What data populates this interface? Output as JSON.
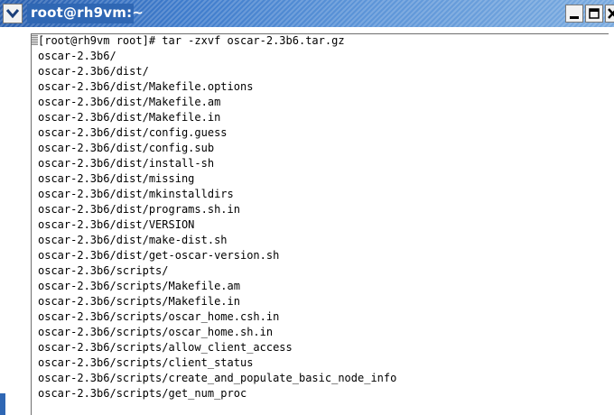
{
  "window": {
    "title": "root@rh9vm:~",
    "controls": [
      "minimize-icon",
      "maximize-icon",
      "close-icon"
    ]
  },
  "colors": {
    "titlebar": "#2c66b4",
    "title_text": "#ffffff",
    "terminal_bg": "#ffffff",
    "terminal_text": "#000000"
  },
  "terminal": {
    "lines": [
      "[root@rh9vm root]# tar -zxvf oscar-2.3b6.tar.gz",
      "oscar-2.3b6/",
      "oscar-2.3b6/dist/",
      "oscar-2.3b6/dist/Makefile.options",
      "oscar-2.3b6/dist/Makefile.am",
      "oscar-2.3b6/dist/Makefile.in",
      "oscar-2.3b6/dist/config.guess",
      "oscar-2.3b6/dist/config.sub",
      "oscar-2.3b6/dist/install-sh",
      "oscar-2.3b6/dist/missing",
      "oscar-2.3b6/dist/mkinstalldirs",
      "oscar-2.3b6/dist/programs.sh.in",
      "oscar-2.3b6/dist/VERSION",
      "oscar-2.3b6/dist/make-dist.sh",
      "oscar-2.3b6/dist/get-oscar-version.sh",
      "oscar-2.3b6/scripts/",
      "oscar-2.3b6/scripts/Makefile.am",
      "oscar-2.3b6/scripts/Makefile.in",
      "oscar-2.3b6/scripts/oscar_home.csh.in",
      "oscar-2.3b6/scripts/oscar_home.sh.in",
      "oscar-2.3b6/scripts/allow_client_access",
      "oscar-2.3b6/scripts/client_status",
      "oscar-2.3b6/scripts/create_and_populate_basic_node_info",
      "oscar-2.3b6/scripts/get_num_proc"
    ]
  }
}
